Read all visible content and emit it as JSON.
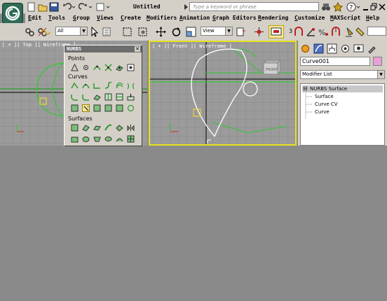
{
  "window": {
    "title": "Untitled",
    "search_placeholder": "Type a keyword or phrase"
  },
  "menu": [
    "Edit",
    "Tools",
    "Group",
    "Views",
    "Create",
    "Modifiers",
    "Animation",
    "Graph Editors",
    "Rendering",
    "Customize",
    "MAXScript",
    "Help"
  ],
  "toolbar": {
    "selection_filter": "All",
    "coord_system": "View",
    "snap_count": "3"
  },
  "viewports": {
    "top_label": "[ + ][ Top ][ Wireframe ]",
    "front_label": "[ + ][ Front ][ Wireframe ]",
    "front_cube_label": "FRONT"
  },
  "nurbs_palette": {
    "title": "NURBS",
    "sections": {
      "points": "Points",
      "curves": "Curves",
      "surfaces": "Surfaces"
    }
  },
  "command_panel": {
    "object_name": "Curve001",
    "object_color": "#e8a0d8",
    "modifier_list": "Modifier List",
    "stack": {
      "root": "NURBS Surface",
      "children": [
        "Surface",
        "Curve CV",
        "Curve"
      ]
    }
  }
}
